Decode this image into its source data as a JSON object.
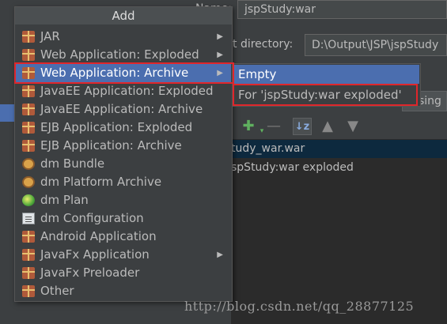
{
  "background": {
    "name_label": "Name:",
    "name_value": "jspStudy:war",
    "output_dir_label": "t directory:",
    "output_dir_value": "D:\\Output\\JSP\\jspStudy",
    "tab_partial": "sing",
    "tree_items": [
      "tudy_war.war",
      "spStudy:war exploded"
    ]
  },
  "popup": {
    "title": "Add",
    "items": [
      {
        "label": "JAR",
        "icon": "package-icon",
        "submenu": true
      },
      {
        "label": "Web Application: Exploded",
        "icon": "web-package-icon",
        "submenu": true
      },
      {
        "label": "Web Application: Archive",
        "icon": "web-package-icon",
        "submenu": true,
        "selected": true
      },
      {
        "label": "JavaEE Application: Exploded",
        "icon": "javaee-package-icon",
        "submenu": false
      },
      {
        "label": "JavaEE Application: Archive",
        "icon": "javaee-package-icon",
        "submenu": false
      },
      {
        "label": "EJB Application: Exploded",
        "icon": "package-icon",
        "submenu": false
      },
      {
        "label": "EJB Application: Archive",
        "icon": "package-icon",
        "submenu": false
      },
      {
        "label": "dm Bundle",
        "icon": "dm-bundle-icon",
        "submenu": false
      },
      {
        "label": "dm Platform Archive",
        "icon": "dm-platform-icon",
        "submenu": false
      },
      {
        "label": "dm Plan",
        "icon": "dm-plan-icon",
        "submenu": false
      },
      {
        "label": "dm Configuration",
        "icon": "document-icon",
        "submenu": false
      },
      {
        "label": "Android Application",
        "icon": "package-icon",
        "submenu": false
      },
      {
        "label": "JavaFx Application",
        "icon": "package-icon",
        "submenu": true
      },
      {
        "label": "JavaFx Preloader",
        "icon": "package-icon",
        "submenu": false
      },
      {
        "label": "Other",
        "icon": "package-icon",
        "submenu": false
      }
    ]
  },
  "submenu": {
    "items": [
      {
        "label": "Empty",
        "selected": true
      },
      {
        "label": "For 'jspStudy:war exploded'",
        "selected": false
      }
    ]
  },
  "watermark": "http://blog.csdn.net/qq_28877125",
  "colors": {
    "selection": "#4b6eaf",
    "highlight_box": "#e0262b",
    "panel": "#3c3f41"
  }
}
